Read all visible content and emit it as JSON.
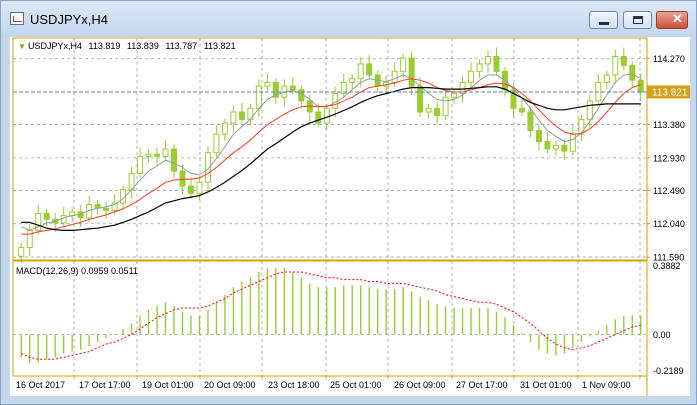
{
  "window": {
    "title": "USDJPYx,H4",
    "buttons": [
      "minimize",
      "maximize",
      "close"
    ]
  },
  "price_header": {
    "symbol": "USDJPYx,H4",
    "open": "113.819",
    "high": "113.839",
    "low": "113.787",
    "close": "113.821"
  },
  "macd_header": "MACD(12,26,9) 0.0959 0.0511",
  "chart_data": [
    {
      "type": "candlestick",
      "name": "USDJPYx,H4",
      "title": "USDJPYx,H4 113.819 113.839 113.787 113.821",
      "ylim": [
        111.55,
        114.55
      ],
      "y_ticks": [
        "114.270",
        "113.821",
        "113.380",
        "112.930",
        "112.490",
        "112.040",
        "111.590"
      ],
      "current_price": "113.821",
      "x_labels": [
        "16 Oct 2017",
        "17 Oct 17:00",
        "19 Oct 01:00",
        "20 Oct 09:00",
        "23 Oct 18:00",
        "25 Oct 01:00",
        "26 Oct 09:00",
        "27 Oct 17:00",
        "31 Oct 01:00",
        "1 Nov 09:00"
      ],
      "grid": true,
      "closes": [
        111.72,
        111.95,
        112.18,
        112.1,
        112.05,
        112.15,
        112.2,
        112.12,
        112.3,
        112.25,
        112.22,
        112.32,
        112.5,
        112.72,
        112.95,
        112.98,
        112.95,
        113.05,
        112.75,
        112.55,
        112.45,
        112.6,
        113.0,
        113.25,
        113.4,
        113.55,
        113.45,
        113.6,
        113.9,
        113.95,
        113.75,
        113.9,
        113.85,
        113.7,
        113.55,
        113.4,
        113.6,
        113.8,
        113.95,
        114.0,
        114.2,
        114.05,
        113.9,
        113.95,
        114.1,
        114.28,
        113.9,
        113.55,
        113.6,
        113.5,
        113.75,
        113.8,
        113.95,
        114.1,
        114.2,
        114.3,
        114.1,
        113.85,
        113.6,
        113.55,
        113.3,
        113.15,
        113.05,
        113.1,
        113.02,
        113.25,
        113.45,
        113.7,
        113.95,
        114.05,
        114.3,
        114.18,
        113.98,
        113.82
      ],
      "fast_ma": [
        112.0,
        111.95,
        112.0,
        112.05,
        112.07,
        112.12,
        112.15,
        112.17,
        112.22,
        112.25,
        112.27,
        112.3,
        112.38,
        112.5,
        112.63,
        112.75,
        112.82,
        112.9,
        112.86,
        112.8,
        112.72,
        112.7,
        112.78,
        112.92,
        113.08,
        113.25,
        113.35,
        113.45,
        113.6,
        113.72,
        113.78,
        113.82,
        113.84,
        113.8,
        113.72,
        113.62,
        113.62,
        113.68,
        113.75,
        113.85,
        113.95,
        114.0,
        113.98,
        113.96,
        114.0,
        114.05,
        114.0,
        113.9,
        113.8,
        113.72,
        113.7,
        113.72,
        113.78,
        113.88,
        113.98,
        114.05,
        114.05,
        113.98,
        113.86,
        113.74,
        113.6,
        113.44,
        113.3,
        113.22,
        113.15,
        113.18,
        113.27,
        113.42,
        113.6,
        113.78,
        113.95,
        114.05,
        114.06,
        114.0
      ],
      "mid_ma": [
        111.9,
        111.9,
        111.93,
        111.95,
        111.97,
        112.0,
        112.03,
        112.06,
        112.1,
        112.13,
        112.16,
        112.2,
        112.24,
        112.3,
        112.37,
        112.45,
        112.52,
        112.6,
        112.63,
        112.64,
        112.64,
        112.66,
        112.72,
        112.8,
        112.9,
        113.0,
        113.08,
        113.17,
        113.28,
        113.38,
        113.45,
        113.52,
        113.58,
        113.62,
        113.63,
        113.62,
        113.63,
        113.65,
        113.7,
        113.75,
        113.82,
        113.88,
        113.9,
        113.92,
        113.94,
        113.98,
        114.0,
        113.98,
        113.94,
        113.88,
        113.84,
        113.82,
        113.82,
        113.85,
        113.88,
        113.92,
        113.94,
        113.93,
        113.88,
        113.8,
        113.7,
        113.58,
        113.46,
        113.36,
        113.28,
        113.25,
        113.26,
        113.32,
        113.42,
        113.55,
        113.68,
        113.8,
        113.88,
        113.92
      ],
      "slow_ma": [
        112.06,
        112.06,
        112.02,
        111.98,
        111.96,
        111.95,
        111.95,
        111.96,
        111.97,
        111.98,
        112.0,
        112.02,
        112.06,
        112.1,
        112.15,
        112.2,
        112.26,
        112.32,
        112.35,
        112.38,
        112.4,
        112.42,
        112.47,
        112.53,
        112.6,
        112.68,
        112.76,
        112.85,
        112.95,
        113.05,
        113.12,
        113.2,
        113.28,
        113.35,
        113.4,
        113.44,
        113.48,
        113.52,
        113.57,
        113.62,
        113.68,
        113.73,
        113.77,
        113.8,
        113.83,
        113.86,
        113.88,
        113.88,
        113.88,
        113.87,
        113.86,
        113.86,
        113.86,
        113.87,
        113.88,
        113.89,
        113.89,
        113.86,
        113.8,
        113.74,
        113.68,
        113.64,
        113.6,
        113.58,
        113.58,
        113.6,
        113.62,
        113.64,
        113.65,
        113.66,
        113.66,
        113.66,
        113.66,
        113.66
      ]
    },
    {
      "type": "bar",
      "name": "MACD(12,26,9)",
      "title": "MACD(12,26,9) 0.0959 0.0511",
      "ylim": [
        -0.2189,
        0.3882
      ],
      "y_ticks": [
        "0.3882",
        "0.00",
        "-0.2189"
      ],
      "histogram": [
        -0.12,
        -0.15,
        -0.15,
        -0.13,
        -0.12,
        -0.1,
        -0.09,
        -0.08,
        -0.06,
        -0.04,
        -0.02,
        0.0,
        0.03,
        0.06,
        0.1,
        0.13,
        0.15,
        0.17,
        0.15,
        0.12,
        0.1,
        0.1,
        0.13,
        0.17,
        0.21,
        0.25,
        0.28,
        0.3,
        0.33,
        0.35,
        0.35,
        0.35,
        0.33,
        0.3,
        0.27,
        0.25,
        0.25,
        0.25,
        0.26,
        0.26,
        0.26,
        0.25,
        0.24,
        0.24,
        0.24,
        0.25,
        0.23,
        0.2,
        0.18,
        0.16,
        0.15,
        0.14,
        0.14,
        0.14,
        0.14,
        0.14,
        0.12,
        0.09,
        0.05,
        0.01,
        -0.04,
        -0.08,
        -0.1,
        -0.11,
        -0.1,
        -0.07,
        -0.04,
        -0.01,
        0.02,
        0.05,
        0.08,
        0.1,
        0.1,
        0.1
      ],
      "signal": [
        -0.1,
        -0.12,
        -0.13,
        -0.13,
        -0.13,
        -0.12,
        -0.11,
        -0.1,
        -0.09,
        -0.07,
        -0.05,
        -0.04,
        -0.02,
        0.0,
        0.03,
        0.06,
        0.09,
        0.11,
        0.13,
        0.14,
        0.14,
        0.14,
        0.15,
        0.17,
        0.19,
        0.22,
        0.24,
        0.26,
        0.28,
        0.3,
        0.32,
        0.33,
        0.33,
        0.33,
        0.32,
        0.31,
        0.3,
        0.3,
        0.29,
        0.29,
        0.29,
        0.28,
        0.28,
        0.27,
        0.27,
        0.27,
        0.26,
        0.25,
        0.24,
        0.23,
        0.21,
        0.2,
        0.19,
        0.18,
        0.17,
        0.17,
        0.16,
        0.14,
        0.12,
        0.09,
        0.06,
        0.02,
        -0.02,
        -0.05,
        -0.07,
        -0.08,
        -0.07,
        -0.06,
        -0.04,
        -0.02,
        0.0,
        0.02,
        0.04,
        0.05
      ]
    }
  ],
  "colors": {
    "frame": "#d2a400",
    "grid": "#a0a0a0",
    "candle": "#9acd32",
    "fast_ma": "#8fa0a0",
    "mid_ma": "#ff3c1e",
    "slow_ma": "#000000",
    "signal": "#ff0000",
    "price_line": "#6c7e9c",
    "price_tag": "#d4a017"
  }
}
